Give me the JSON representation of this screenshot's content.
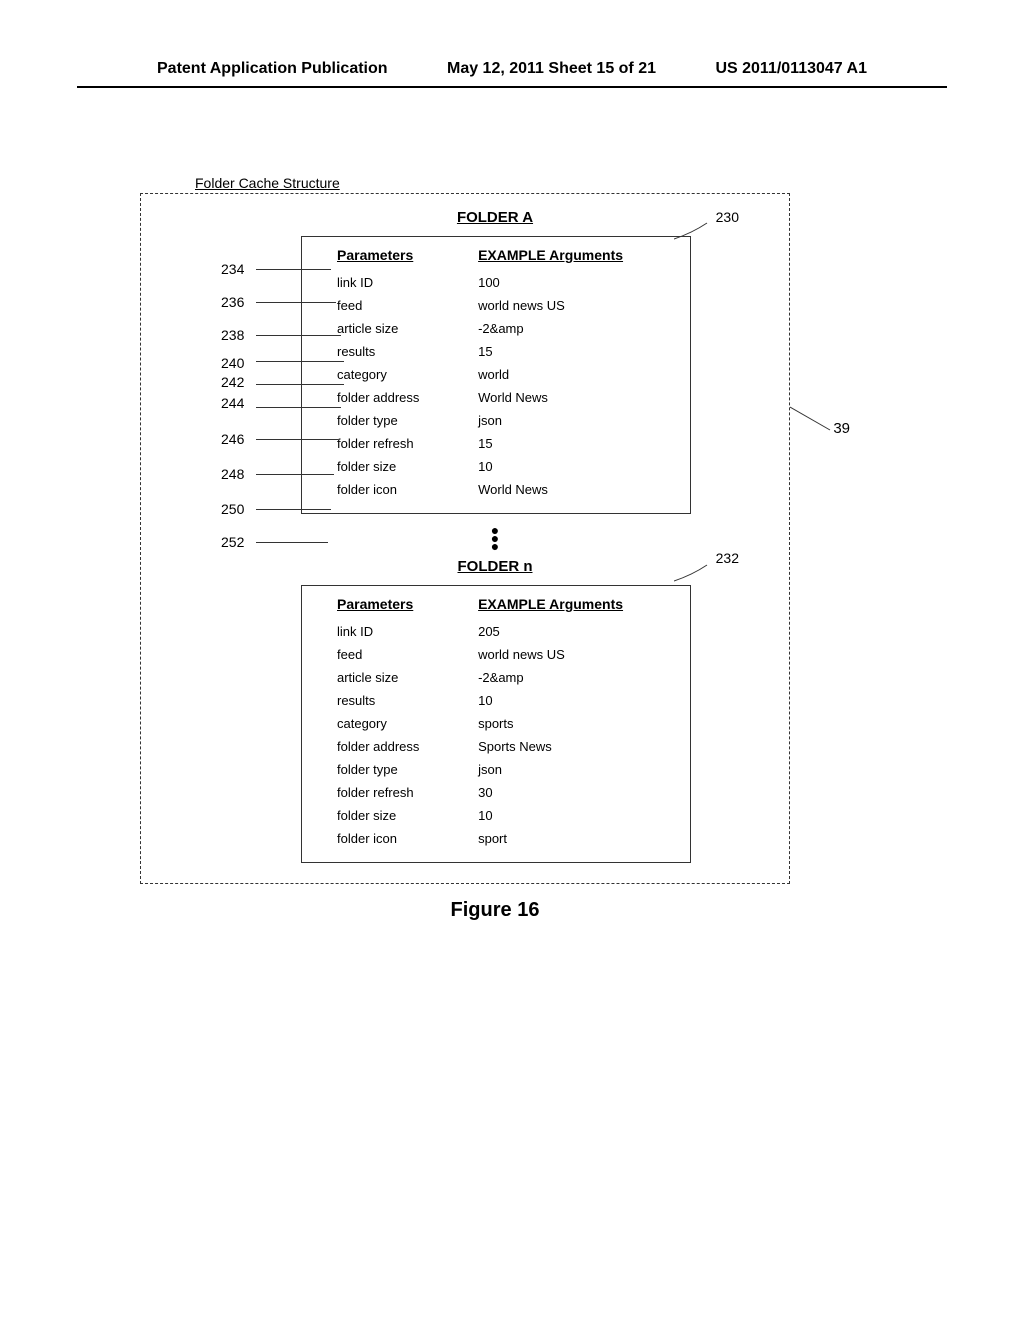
{
  "header": {
    "left": "Patent Application Publication",
    "center": "May 12, 2011  Sheet 15 of 21",
    "right": "US 2011/0113047 A1"
  },
  "structure_title": "Folder Cache Structure",
  "folder_a": {
    "title": "FOLDER A",
    "ref": "230",
    "col_headers": [
      "Parameters",
      "EXAMPLE Arguments"
    ],
    "rows": [
      {
        "ref": "234",
        "param": "link ID",
        "arg": "100"
      },
      {
        "ref": "236",
        "param": "feed",
        "arg": "world news US"
      },
      {
        "ref": "238",
        "param": "article size",
        "arg": "-2&amp"
      },
      {
        "ref": "240",
        "param": "results",
        "arg": "15"
      },
      {
        "ref": "242",
        "param": "category",
        "arg": "world"
      },
      {
        "ref": "244",
        "param": "folder address",
        "arg": "World News"
      },
      {
        "ref": "246",
        "param": "folder type",
        "arg": "json"
      },
      {
        "ref": "248",
        "param": "folder refresh",
        "arg": "15"
      },
      {
        "ref": "250",
        "param": "folder size",
        "arg": "10"
      },
      {
        "ref": "252",
        "param": "folder icon",
        "arg": "World News"
      }
    ]
  },
  "folder_n": {
    "title": "FOLDER n",
    "ref": "232",
    "col_headers": [
      "Parameters",
      "EXAMPLE Arguments"
    ],
    "rows": [
      {
        "param": "link ID",
        "arg": "205"
      },
      {
        "param": "feed",
        "arg": "world news US"
      },
      {
        "param": "article size",
        "arg": "-2&amp"
      },
      {
        "param": "results",
        "arg": "10"
      },
      {
        "param": "category",
        "arg": "sports"
      },
      {
        "param": "folder address",
        "arg": "Sports News"
      },
      {
        "param": "folder type",
        "arg": "json"
      },
      {
        "param": "folder refresh",
        "arg": "30"
      },
      {
        "param": "folder size",
        "arg": "10"
      },
      {
        "param": "folder icon",
        "arg": "sport"
      }
    ]
  },
  "outer_ref": "39",
  "figure_caption": "Figure 16"
}
